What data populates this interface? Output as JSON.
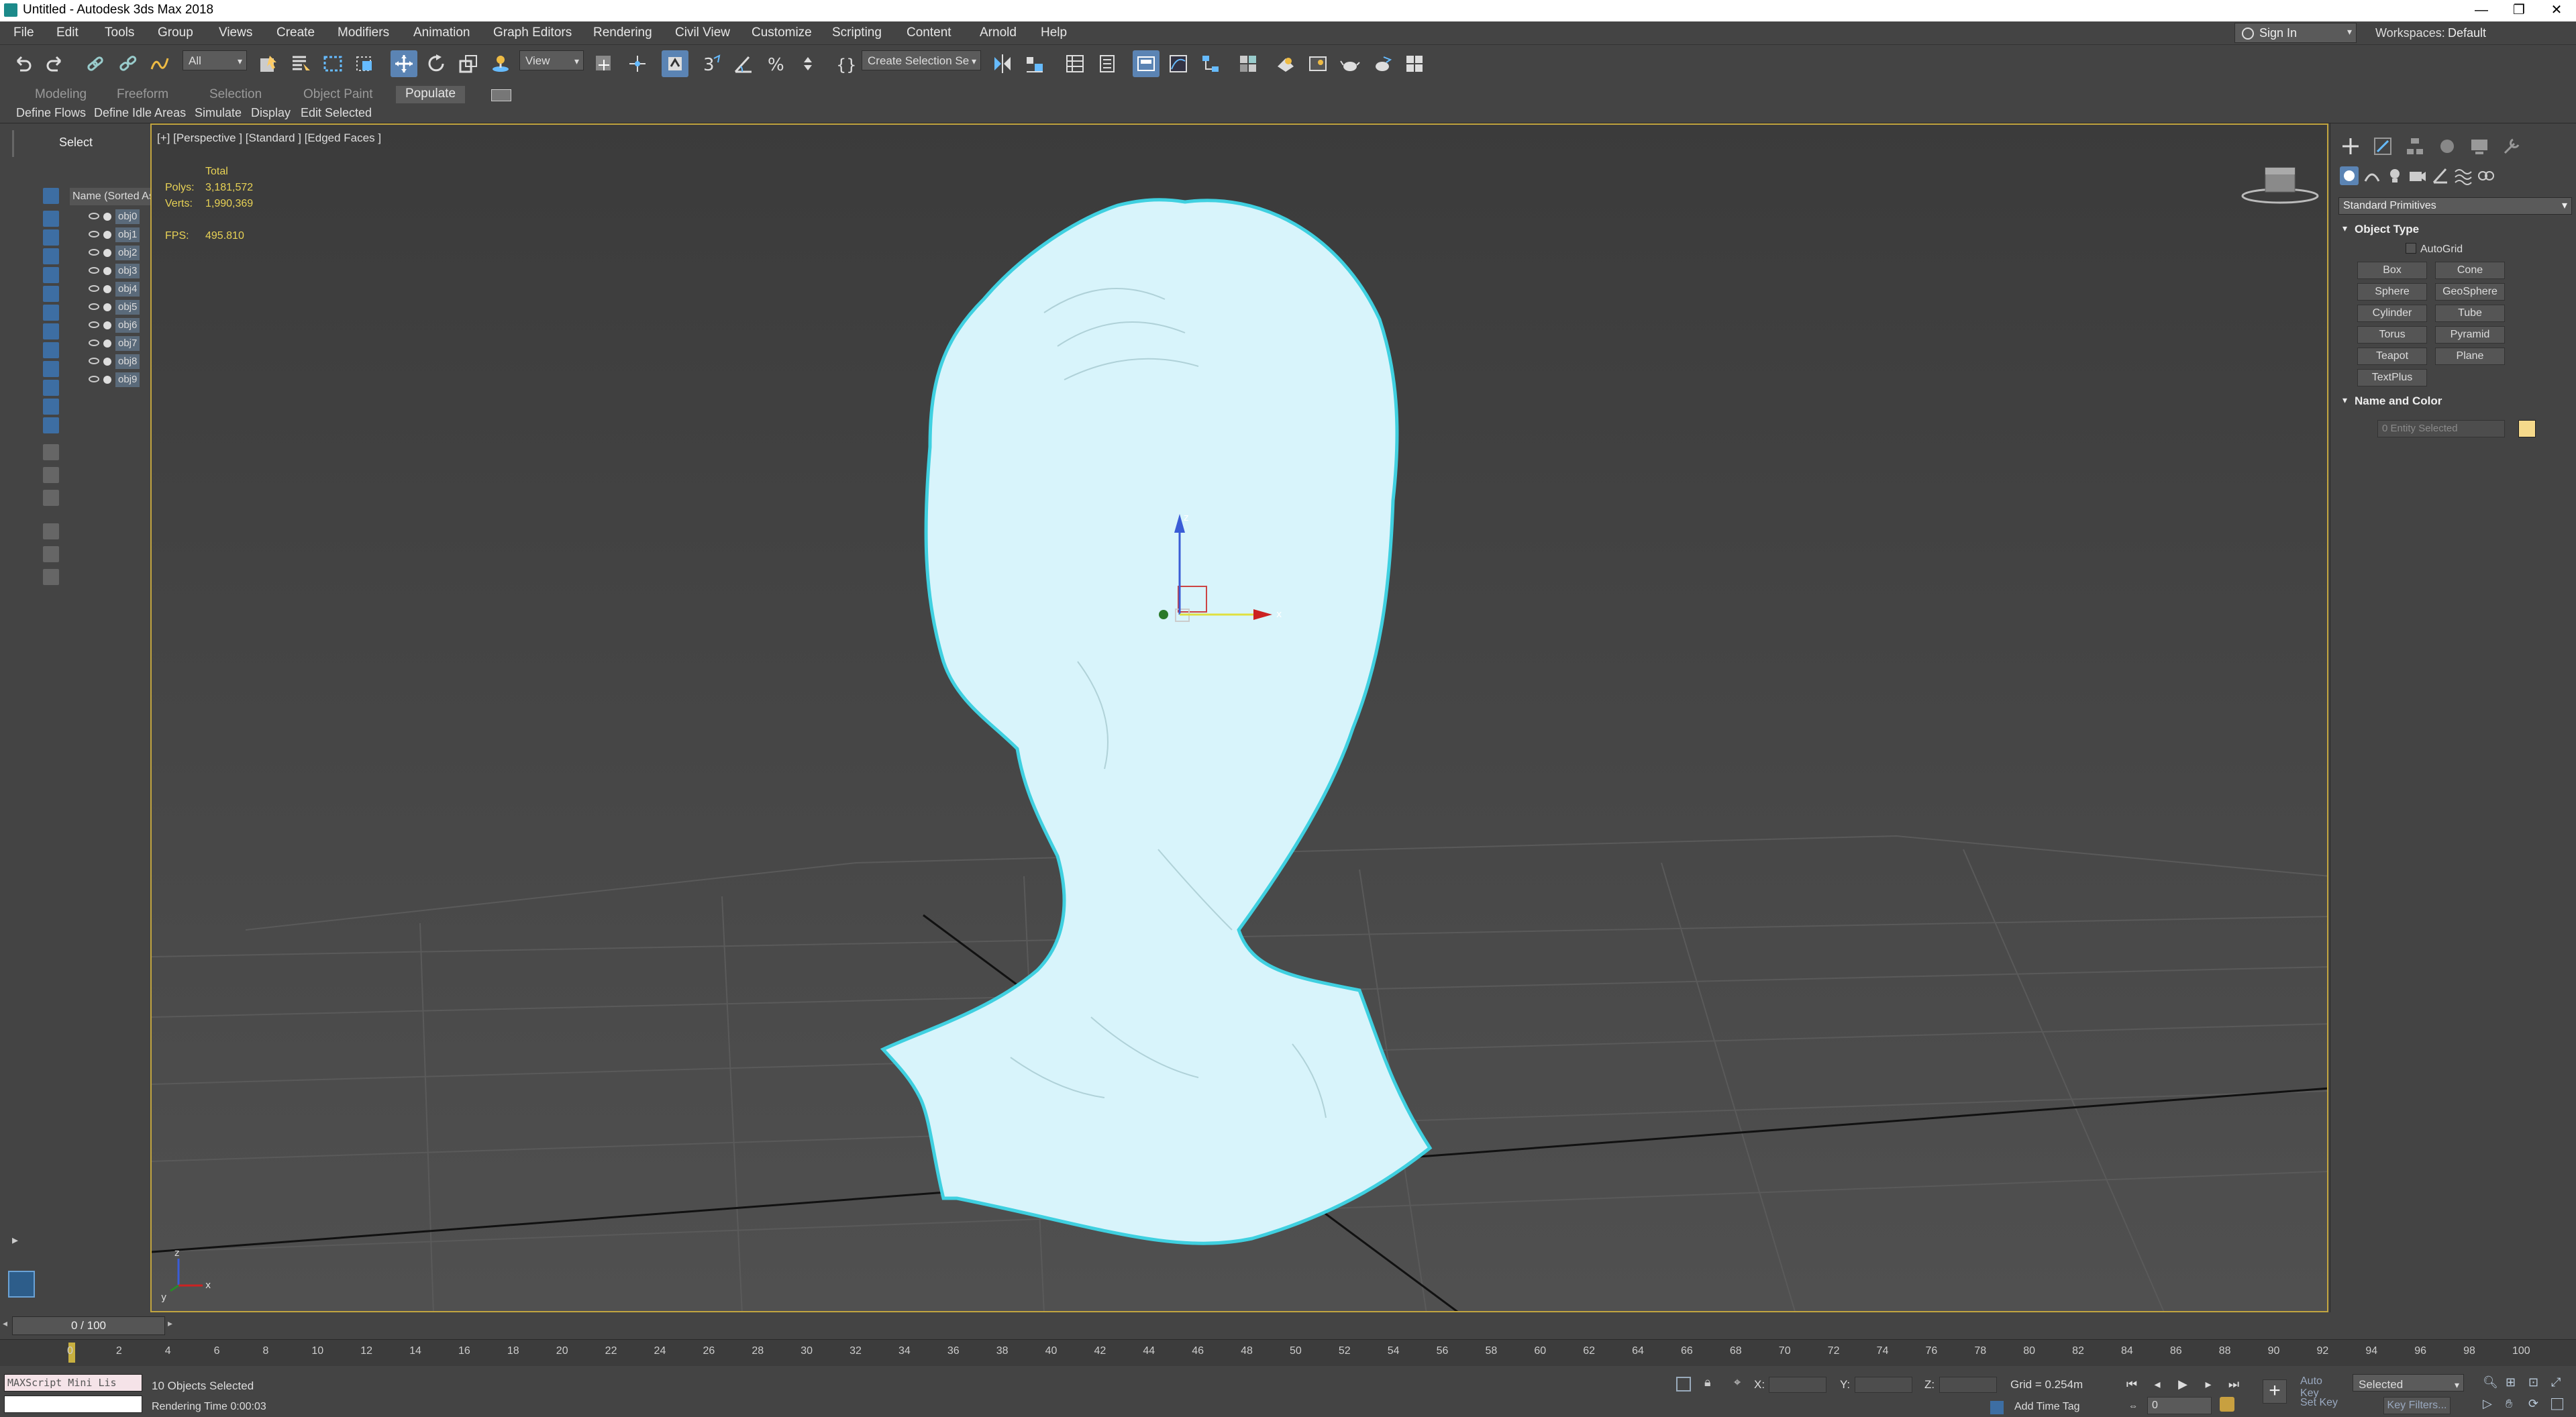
{
  "window": {
    "title": "Untitled - Autodesk 3ds Max 2018",
    "minimize": "—",
    "restore": "❐",
    "close": "✕"
  },
  "menu": [
    "File",
    "Edit",
    "Tools",
    "Group",
    "Views",
    "Create",
    "Modifiers",
    "Animation",
    "Graph Editors",
    "Rendering",
    "Civil View",
    "Customize",
    "Scripting",
    "Content",
    "Arnold",
    "Help"
  ],
  "account": {
    "sign_in": "Sign In",
    "workspaces_label": "Workspaces:",
    "workspace": "Default"
  },
  "toolbar": {
    "filter": "All",
    "ref_coord": "View",
    "named_selection": "Create Selection Se"
  },
  "ribbon": {
    "tabs": [
      "Modeling",
      "Freeform",
      "Selection",
      "Object Paint",
      "Populate"
    ],
    "active": "Populate",
    "buttons": [
      "Define Flows",
      "Define Idle Areas",
      "Simulate",
      "Display",
      "Edit Selected"
    ]
  },
  "scene_explorer": {
    "title": "Select",
    "column": "Name (Sorted Ascending)",
    "objects": [
      "obj0",
      "obj1",
      "obj2",
      "obj3",
      "obj4",
      "obj5",
      "obj6",
      "obj7",
      "obj8",
      "obj9"
    ]
  },
  "viewport": {
    "label": "[+] [Perspective ] [Standard ] [Edged Faces ]",
    "stats": {
      "total": "Total",
      "polys_label": "Polys:",
      "polys": "3,181,572",
      "verts_label": "Verts:",
      "verts": "1,990,369",
      "fps_label": "FPS:",
      "fps": "495.810"
    },
    "axes": {
      "x": "x",
      "y": "y",
      "z": "z"
    }
  },
  "command_panel": {
    "category": "Standard Primitives",
    "object_type": {
      "title": "Object Type",
      "autogrid": "AutoGrid",
      "buttons": [
        "Box",
        "Cone",
        "Sphere",
        "GeoSphere",
        "Cylinder",
        "Tube",
        "Torus",
        "Pyramid",
        "Teapot",
        "Plane",
        "TextPlus"
      ]
    },
    "name_color": {
      "title": "Name and Color",
      "placeholder": "0 Entity Selected",
      "color": "#f5d98b"
    }
  },
  "timeline": {
    "slider": "0 / 100",
    "ticks": [
      "0",
      "2",
      "4",
      "6",
      "8",
      "10",
      "12",
      "14",
      "16",
      "18",
      "20",
      "22",
      "24",
      "26",
      "28",
      "30",
      "32",
      "34",
      "36",
      "38",
      "40",
      "42",
      "44",
      "46",
      "48",
      "50",
      "52",
      "54",
      "56",
      "58",
      "60",
      "62",
      "64",
      "66",
      "68",
      "70",
      "72",
      "74",
      "76",
      "78",
      "80",
      "82",
      "84",
      "86",
      "88",
      "90",
      "92",
      "94",
      "96",
      "98",
      "100"
    ]
  },
  "status": {
    "maxscript": "MAXScript Mini Lis",
    "selection": "10 Objects Selected",
    "rendering_time": "Rendering Time  0:00:03",
    "x_label": "X:",
    "y_label": "Y:",
    "z_label": "Z:",
    "grid": "Grid = 0.254m",
    "add_time_tag": "Add Time Tag",
    "auto_key": "Auto Key",
    "set_key": "Set Key",
    "key_mode": "Selected",
    "key_filters": "Key Filters...",
    "frame": "0"
  },
  "colors": {
    "viewport_border": "#c2a540",
    "stats": "#e8d255",
    "mesh": "#d8f4fb",
    "mesh_outline": "#3fd0e0",
    "active_tab": "#5b84b4"
  }
}
